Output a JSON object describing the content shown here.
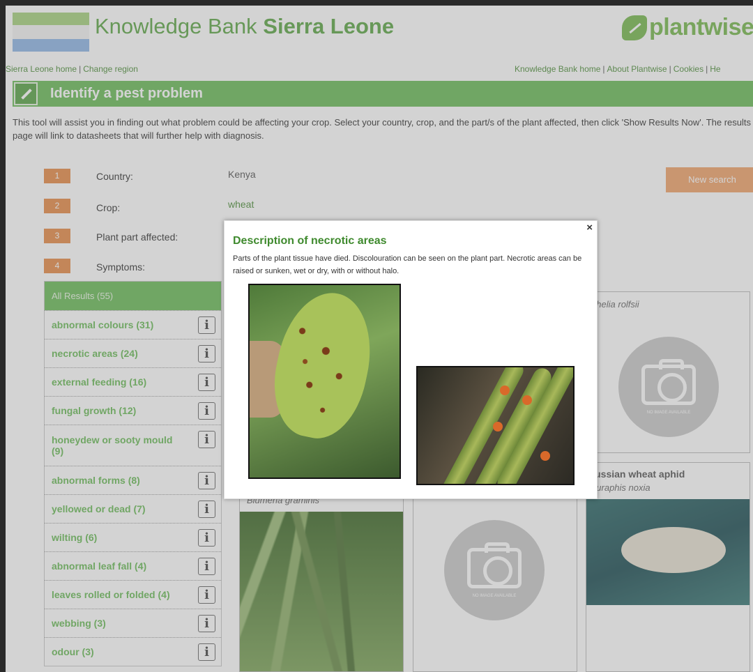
{
  "header": {
    "site_title_regular": "Knowledge Bank",
    "site_title_bold": "Sierra Leone",
    "logo_text": "plantwise"
  },
  "nav_left": [
    "Sierra Leone home",
    "Change region"
  ],
  "nav_right": [
    "Knowledge Bank home",
    "About Plantwise",
    "Cookies",
    "He"
  ],
  "page_title": "Identify a pest problem",
  "intro": "This tool will assist you in finding out what problem could be affecting your crop. Select your country, crop, and the part/s of the plant affected, then click 'Show Results Now'. The results page will link to datasheets that will further help with diagnosis.",
  "steps": [
    {
      "num": "1",
      "label": "Country:",
      "value": "Kenya"
    },
    {
      "num": "2",
      "label": "Crop:",
      "value": "wheat"
    },
    {
      "num": "3",
      "label": "Plant part affected:",
      "value": ""
    },
    {
      "num": "4",
      "label": "Symptoms:",
      "value": ""
    }
  ],
  "new_search_label": "New search",
  "filters": {
    "all_results": "All Results (55)",
    "info_glyph": "i",
    "items": [
      "abnormal colours (31)",
      "necrotic areas (24)",
      "external feeding (16)",
      "fungal growth (12)",
      "honeydew or sooty mould (9)",
      "abnormal forms (8)",
      "yellowed or dead (7)",
      "wilting (6)",
      "abnormal leaf fall (4)",
      "leaves rolled or folded (4)",
      "webbing (3)",
      "odour (3)"
    ]
  },
  "results": {
    "card_athelia_sci": "Athelia rolfsii",
    "card_russian_title": "Russian wheat aphid",
    "card_russian_sci": "Diuraphis noxia",
    "card_blumeria_sci": "Blumeria graminis",
    "no_image_text": "NO IMAGE AVAILABLE"
  },
  "modal": {
    "close": "×",
    "title": "Description of necrotic areas",
    "description": "Parts of the plant tissue have died. Discolouration can be seen on the plant part. Necrotic areas can be raised or sunken, wet or dry, with or without halo."
  },
  "colors": {
    "brand_green": "#6cbc5a",
    "step_orange": "#e88d49",
    "modal_title_green": "#3f8a2e"
  }
}
